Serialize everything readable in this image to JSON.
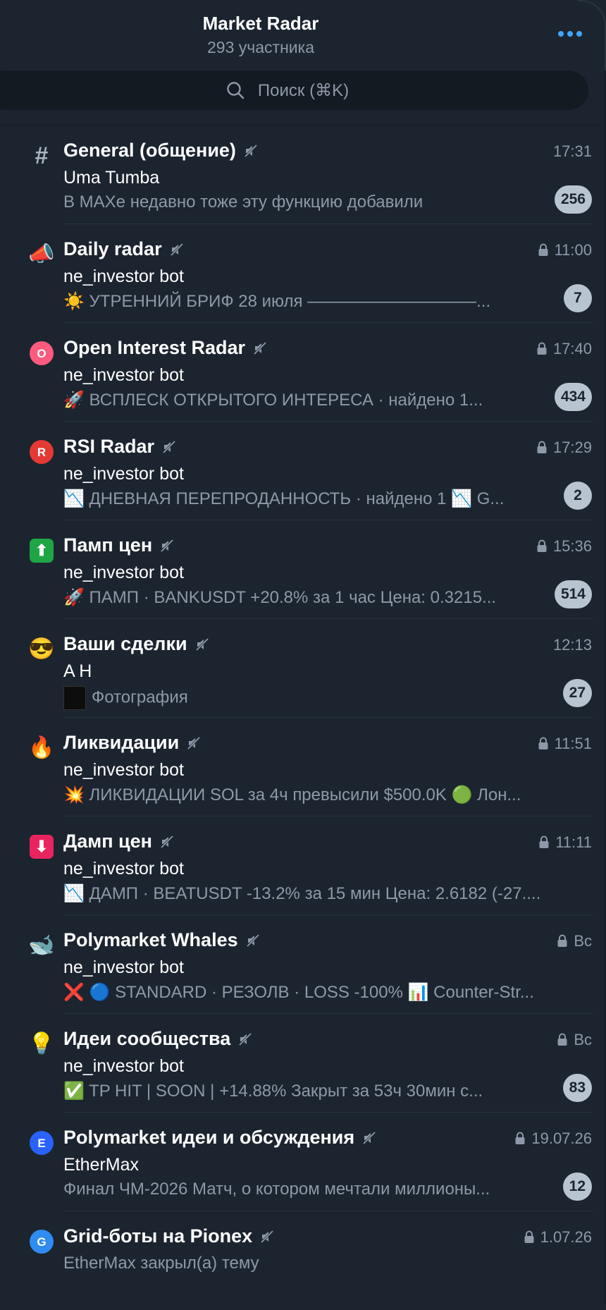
{
  "header": {
    "title": "Market Radar",
    "subtitle": "293 участника",
    "more_icon": "ellipsis-icon",
    "accent": "#3ea6ff"
  },
  "search": {
    "placeholder": "Поиск (⌘K)",
    "icon": "search-icon"
  },
  "chats": [
    {
      "icon": "#",
      "title": "General (общение)",
      "time": "17:31",
      "locked": false,
      "sender": "Uma Tumba",
      "preview": "В MAXе недавно тоже эту функцию добавили",
      "badge": "256"
    },
    {
      "icon": "📣",
      "title": "Daily radar",
      "time": "11:00",
      "locked": true,
      "sender": "ne_investor bot",
      "preview": "☀️ УТРЕННИЙ БРИФ 28 июля ——————————...",
      "badge": "7"
    },
    {
      "icon": "O",
      "title": "Open Interest Radar",
      "time": "17:40",
      "locked": true,
      "sender": "ne_investor bot",
      "preview": "🚀 ВСПЛЕСК ОТКРЫТОГО ИНТЕРЕСА · найдено 1...",
      "badge": "434"
    },
    {
      "icon": "R",
      "title": "RSI Radar",
      "time": "17:29",
      "locked": true,
      "sender": "ne_investor bot",
      "preview": "📉 ДНЕВНАЯ ПЕРЕПРОДАННОСТЬ · найдено 1 📉 G...",
      "badge": "2"
    },
    {
      "icon": "⬆",
      "title": "Памп цен",
      "time": "15:36",
      "locked": true,
      "sender": "ne_investor bot",
      "preview": "🚀 ПАМП · BANKUSDT +20.8% за 1 час Цена: 0.3215...",
      "badge": "514"
    },
    {
      "icon": "😎",
      "title": "Ваши сделки",
      "time": "12:13",
      "locked": false,
      "sender": "A H",
      "preview": "Фотография",
      "badge": "27"
    },
    {
      "icon": "🔥",
      "title": "Ликвидации",
      "time": "11:51",
      "locked": true,
      "sender": "ne_investor bot",
      "preview": "💥 ЛИКВИДАЦИИ SOL за 4ч превысили $500.0K 🟢 Лон...",
      "badge": ""
    },
    {
      "icon": "⬇",
      "title": "Дамп цен",
      "time": "11:11",
      "locked": true,
      "sender": "ne_investor bot",
      "preview": "📉 ДАМП · BEATUSDT -13.2% за 15 мин Цена: 2.6182 (-27....",
      "badge": ""
    },
    {
      "icon": "🐋",
      "title": "Polymarket Whales",
      "time": "Вс",
      "locked": true,
      "sender": "ne_investor bot",
      "preview": "❌ 🔵 STANDARD · РЕЗОЛВ · LOSS -100% 📊 Counter-Str...",
      "badge": ""
    },
    {
      "icon": "💡",
      "title": "Идеи сообщества",
      "time": "Вс",
      "locked": true,
      "sender": "ne_investor bot",
      "preview": "✅ TP HIT | SOON | +14.88% Закрыт за 53ч 30мин с...",
      "badge": "83"
    },
    {
      "icon": "E",
      "title": "Polymarket идеи и обсуждения",
      "time": "19.07.26",
      "locked": true,
      "sender": "EtherMax",
      "preview": "Финал ЧМ-2026 Матч, о котором мечтали миллионы...",
      "badge": "12"
    },
    {
      "icon": "G",
      "title": "Grid-боты на Pionex",
      "time": "1.07.26",
      "locked": true,
      "sender": "",
      "preview": "EtherMax закрыл(а) тему",
      "badge": ""
    }
  ],
  "colors": {
    "background": "#1c242f",
    "search_bg": "#141a22",
    "secondary_text": "#8d99a8",
    "badge_bg": "#b9c4d1"
  }
}
